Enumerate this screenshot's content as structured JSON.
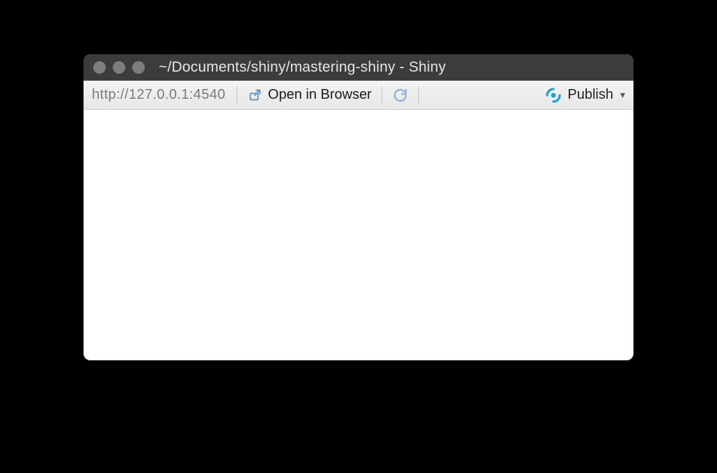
{
  "window": {
    "title": "~/Documents/shiny/mastering-shiny - Shiny"
  },
  "toolbar": {
    "url": "http://127.0.0.1:4540",
    "open_in_browser_label": "Open in Browser",
    "publish_label": "Publish"
  }
}
